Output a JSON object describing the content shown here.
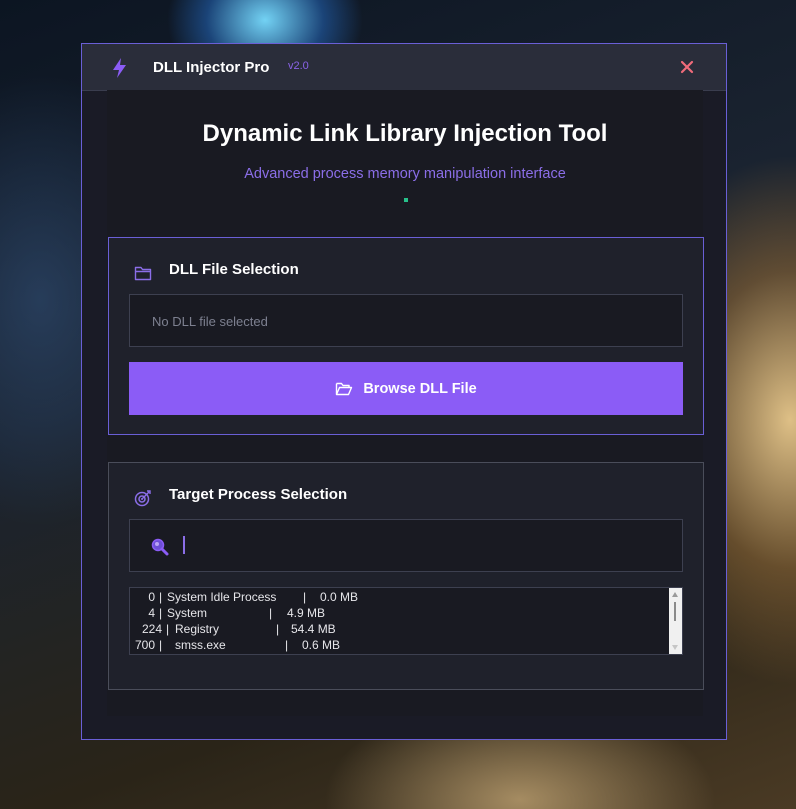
{
  "window": {
    "title": "DLL Injector Pro",
    "version": "v2.0",
    "close_icon": "x-icon"
  },
  "header": {
    "title": "Dynamic Link Library Injection Tool",
    "subtitle": "Advanced process memory manipulation interface"
  },
  "dll_panel": {
    "title": "DLL File Selection",
    "icon": "folder-icon",
    "file_placeholder": "No DLL file selected",
    "browse_label": "Browse DLL File",
    "browse_icon": "folder-open-icon"
  },
  "process_panel": {
    "title": "Target Process Selection",
    "icon": "target-icon",
    "search_icon": "search-icon",
    "search_value": "",
    "processes": [
      {
        "pid": "0",
        "name": "System Idle Process",
        "mem": "0.0 MB"
      },
      {
        "pid": "4",
        "name": "System",
        "mem": "4.9 MB"
      },
      {
        "pid": "224",
        "name": "Registry",
        "mem": "54.4 MB"
      },
      {
        "pid": "700",
        "name": "smss.exe",
        "mem": "0.6 MB"
      }
    ]
  },
  "colors": {
    "accent": "#8b5cf6",
    "window_border": "#6a5fd6",
    "status_dot": "#27c08a",
    "close": "#f06b7a"
  }
}
